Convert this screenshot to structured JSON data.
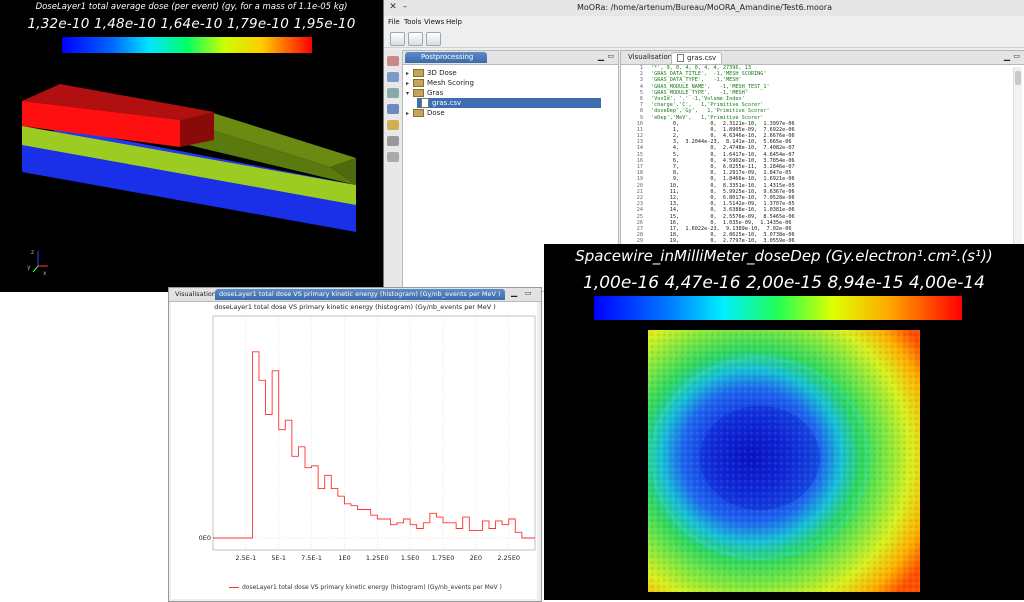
{
  "window_3d": {
    "title": "DoseLayer1 total average dose (per event)  (gy, for a mass of 1.1e-05 kg)",
    "colorbar_ticks": "1,32e-10 1,48e-10 1,64e-10 1,79e-10 1,95e-10",
    "axis_labels": {
      "x": "x",
      "y": "y",
      "z": "z"
    }
  },
  "main_window": {
    "title": "MoORa: /home/artenum/Bureau/MoORA_Amandine/Test6.moora",
    "menu": [
      "File",
      "Tools",
      "Views",
      "Help"
    ],
    "toolbar_icons": [
      "open-icon",
      "save-icon",
      "tools-icon"
    ],
    "postprocessing": {
      "tab_label": "Postprocessing",
      "tree": [
        {
          "label": "3D Dose",
          "level": 0,
          "type": "folder",
          "expanded": false
        },
        {
          "label": "Mesh Scoring",
          "level": 0,
          "type": "folder",
          "expanded": false
        },
        {
          "label": "Gras",
          "level": 0,
          "type": "folder",
          "expanded": true
        },
        {
          "label": "gras.csv",
          "level": 1,
          "type": "file",
          "selected": true
        },
        {
          "label": "Dose",
          "level": 0,
          "type": "folder",
          "expanded": false
        }
      ]
    },
    "editor": {
      "tabs": [
        "Visualisation",
        "gras.csv"
      ],
      "active_tab": 1,
      "lines": [
        "'*', 9, 0, 4, 0, 4, 4, 27396, 13",
        "'GRAS_DATA_TITLE',  -1,'MESH SCORING'",
        "'GRAS_DATA_TYPE',   -1,'MESH'",
        "'GRAS_MODULE_NAME',   -1,'MESH_TEST_1'",
        "'GRAS_MODULE_TYPE',   -1,'MESH'",
        "'VoxId', ',' -1,'Volume Index'",
        "'charge','C',   1,'Primitive Scorer'",
        "'doseDep','Gy',   1,'Primitive Scorer'",
        "'eDep','MeV',   1,'Primitive Scorer'",
        "       0,          0,  2.3121e-10,  1.3997e-06",
        "       1,          0,  1.8905e-09,  7.6922e-06",
        "       2,          0,  4.6346e-10,  2.6676e-06",
        "       3,  3.2044e-23,  8.141e-10,  5.665e-06",
        "       4,          0,  2.4748e-10,  7.4082e-07",
        "       5,          0,  1.6417e-10,  4.6454e-07",
        "       6,          0,  4.5902e-10,  3.7854e-06",
        "       7,          0,  6.0255e-11,  3.2846e-07",
        "       8,          0,  1.2917e-09,  1.847e-05",
        "       9,          0,  1.8466e-10,  1.6921e-06",
        "      10,          0,  8.3351e-10,  1.4315e-05",
        "      11,          0,  5.9925e-10,  9.6367e-06",
        "      12,          0,  6.8017e-10,  7.0528e-06",
        "      13,          0,  1.5142e-09,  1.3707e-05",
        "      14,          0,  3.6388e-10,  1.0381e-06",
        "      15,          0,  2.5576e-09,  8.5465e-06",
        "      16,          0,  1.035e-09,  1.1435e-06",
        "      17,  1.6022e-23,  9.1389e-10,  7.02e-06",
        "      18,          0,  2.8625e-10,  3.0738e-06",
        "      19,          0,  2.7797e-10,  3.0559e-06",
        "      20,          0,  1.3881e-09,  9.9738e-06"
      ]
    }
  },
  "histogram_window": {
    "tabs": [
      "Visualisation",
      "doseLayer1 total dose VS primary kinetic energy (histogram) (Gy/nb_events per MeV )"
    ],
    "chart_data": {
      "type": "line",
      "title": "doseLayer1 total dose VS primary kinetic energy (histogram) (Gy/nb_events per MeV )",
      "legend": "doseLayer1 total dose VS primary kinetic energy (histogram) (Gy/nb_events per MeV )",
      "legend_position": "bottom",
      "xlim": [
        0,
        2.45
      ],
      "x_ticks": [
        {
          "v": 0.25,
          "label": "2.5E-1"
        },
        {
          "v": 0.5,
          "label": "5E-1"
        },
        {
          "v": 0.75,
          "label": "7.5E-1"
        },
        {
          "v": 1.0,
          "label": "1E0"
        },
        {
          "v": 1.25,
          "label": "1.25E0"
        },
        {
          "v": 1.5,
          "label": "1.5E0"
        },
        {
          "v": 1.75,
          "label": "1.75E0"
        },
        {
          "v": 2.0,
          "label": "2E0"
        },
        {
          "v": 2.25,
          "label": "2.25E0"
        }
      ],
      "y_ticks": [
        {
          "v": 0,
          "label": "0E0"
        }
      ],
      "ylim": [
        0,
        1
      ],
      "x": [
        0,
        0.2,
        0.3,
        0.35,
        0.4,
        0.45,
        0.5,
        0.55,
        0.6,
        0.65,
        0.7,
        0.75,
        0.8,
        0.85,
        0.9,
        0.95,
        1.0,
        1.05,
        1.1,
        1.15,
        1.2,
        1.25,
        1.3,
        1.35,
        1.4,
        1.45,
        1.5,
        1.55,
        1.6,
        1.65,
        1.7,
        1.75,
        1.8,
        1.85,
        1.9,
        1.95,
        2.0,
        2.05,
        2.1,
        2.15,
        2.2,
        2.25,
        2.3,
        2.35,
        2.45
      ],
      "y": [
        0,
        0,
        0.98,
        0.83,
        0.65,
        0.88,
        0.57,
        0.62,
        0.43,
        0.48,
        0.37,
        0.38,
        0.26,
        0.33,
        0.26,
        0.22,
        0.18,
        0.17,
        0.15,
        0.15,
        0.12,
        0.1,
        0.1,
        0.07,
        0.08,
        0.1,
        0.07,
        0.05,
        0.08,
        0.13,
        0.11,
        0.08,
        0.08,
        0.05,
        0.11,
        0.04,
        0.04,
        0.09,
        0.05,
        0.09,
        0.07,
        0.1,
        0.03,
        0,
        0
      ]
    }
  },
  "spacewire_window": {
    "title": "Spacewire_inMilliMeter_doseDep (Gy.electron¹.cm².(s¹))",
    "colorbar_ticks": "1,00e-16 4,47e-16 2,00e-15 8,94e-15 4,00e-14"
  }
}
